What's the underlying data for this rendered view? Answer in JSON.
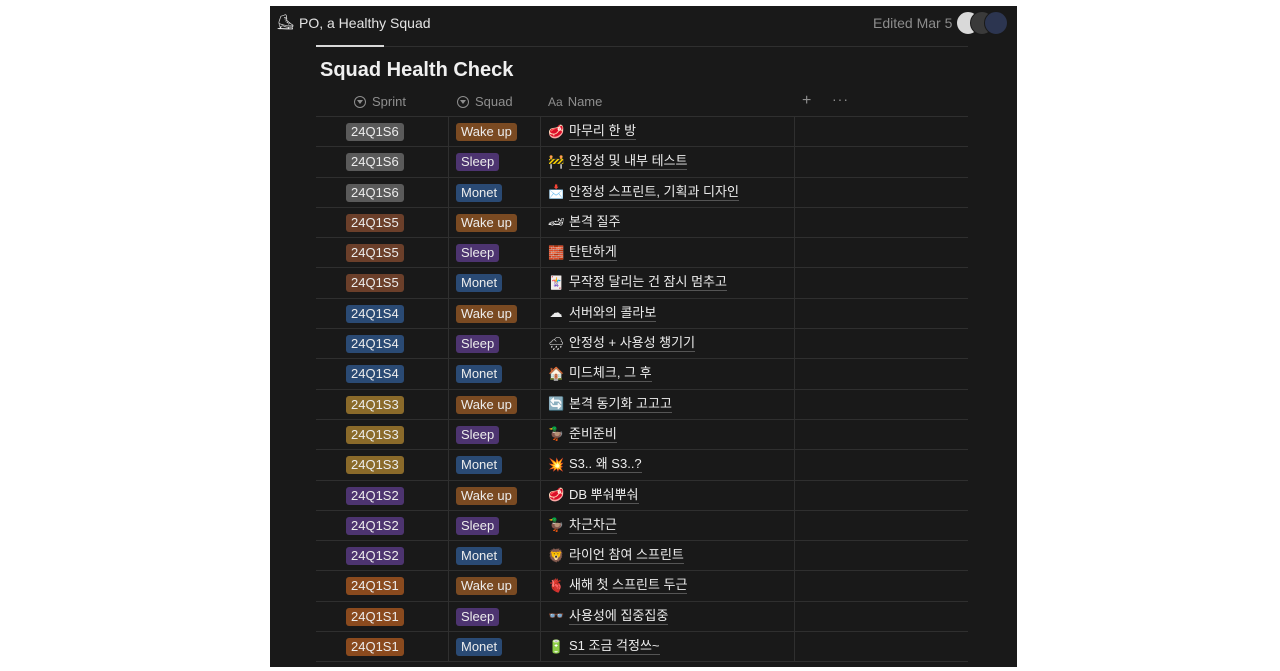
{
  "topbar": {
    "page_icon": "⛸",
    "page_title": "PO, a Healthy Squad",
    "edited": "Edited Mar 5"
  },
  "database": {
    "title": "Squad Health Check",
    "columns": [
      {
        "label": "Sprint",
        "icon": "select-icon"
      },
      {
        "label": "Squad",
        "icon": "select-icon"
      },
      {
        "label": "Name",
        "icon": "text-icon",
        "prefix": "Aa"
      }
    ],
    "add_label": "+",
    "more_label": "···"
  },
  "colors": {
    "sprint": {
      "S6": "#5a5a5a",
      "S5": "#6b3f2a",
      "S4": "#2a4a74",
      "S3": "#8a6a2a",
      "S2": "#4d3470",
      "S1": "#8a4a1e"
    },
    "squad": {
      "Wake up": "#7a4a22",
      "Sleep": "#4d3470",
      "Monet": "#2a4a74"
    }
  },
  "rows": [
    {
      "sprint": "24Q1S6",
      "squad": "Wake up",
      "emoji": "🥩",
      "name": "마무리 한 방"
    },
    {
      "sprint": "24Q1S6",
      "squad": "Sleep",
      "emoji": "🚧",
      "name": "안정성 및 내부 테스트"
    },
    {
      "sprint": "24Q1S6",
      "squad": "Monet",
      "emoji": "📩",
      "name": "안정성 스프린트, 기획과 디자인"
    },
    {
      "sprint": "24Q1S5",
      "squad": "Wake up",
      "emoji": "🏎",
      "name": "본격 질주"
    },
    {
      "sprint": "24Q1S5",
      "squad": "Sleep",
      "emoji": "🧱",
      "name": "탄탄하게"
    },
    {
      "sprint": "24Q1S5",
      "squad": "Monet",
      "emoji": "🃏",
      "name": " 무작정 달리는 건 잠시 멈추고"
    },
    {
      "sprint": "24Q1S4",
      "squad": "Wake up",
      "emoji": "☁",
      "name": "서버와의 콜라보"
    },
    {
      "sprint": "24Q1S4",
      "squad": "Sleep",
      "emoji": "🌧",
      "name": "안정성 + 사용성 챙기기"
    },
    {
      "sprint": "24Q1S4",
      "squad": "Monet",
      "emoji": "🏠",
      "name": "미드체크, 그 후"
    },
    {
      "sprint": "24Q1S3",
      "squad": "Wake up",
      "emoji": "🔄",
      "name": "본격 동기화 고고고"
    },
    {
      "sprint": "24Q1S3",
      "squad": "Sleep",
      "emoji": "🦆",
      "name": "준비준비"
    },
    {
      "sprint": "24Q1S3",
      "squad": "Monet",
      "emoji": "💥",
      "name": "S3.. 왜 S3..?"
    },
    {
      "sprint": "24Q1S2",
      "squad": "Wake up",
      "emoji": "🥩",
      "name": "DB 뿌숴뿌숴"
    },
    {
      "sprint": "24Q1S2",
      "squad": "Sleep",
      "emoji": "🦆",
      "name": "차근차근"
    },
    {
      "sprint": "24Q1S2",
      "squad": "Monet",
      "emoji": "🦁",
      "name": "라이언 참여 스프린트"
    },
    {
      "sprint": "24Q1S1",
      "squad": "Wake up",
      "emoji": "🫀",
      "name": "새해 첫 스프린트 두근"
    },
    {
      "sprint": "24Q1S1",
      "squad": "Sleep",
      "emoji": "👓",
      "name": "사용성에 집중집중"
    },
    {
      "sprint": "24Q1S1",
      "squad": "Monet",
      "emoji": "🔋",
      "name": "S1 조금 걱정쓰~"
    }
  ]
}
